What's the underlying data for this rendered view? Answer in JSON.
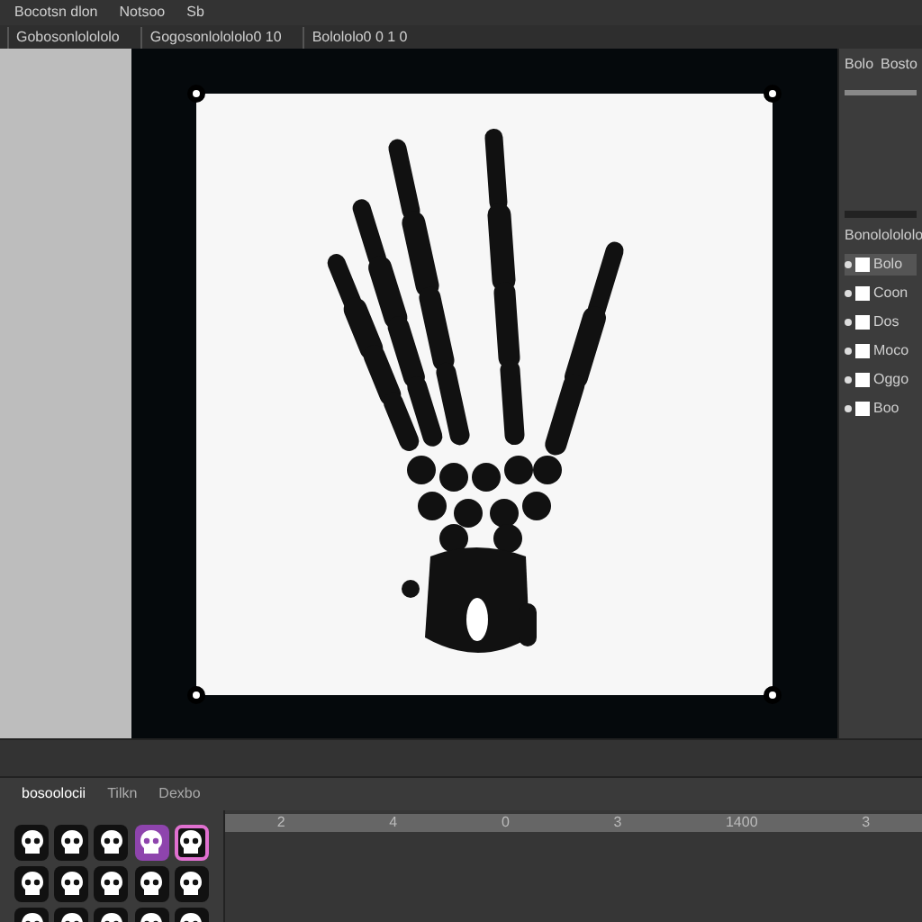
{
  "menu": [
    "Bocotsn dlon",
    "Notsoo",
    "Sb"
  ],
  "toolbar": [
    "Gobosonlolololo",
    "Gogosonlolololo0 10",
    "Bolololo0 0 1 0"
  ],
  "properties_panel": {
    "tabs": [
      "Bolo",
      "Bosto"
    ]
  },
  "layers_panel": {
    "title": "Bonololololo",
    "layers": [
      {
        "name": "Bolo",
        "selected": true
      },
      {
        "name": "Coon",
        "selected": false
      },
      {
        "name": "Dos",
        "selected": false
      },
      {
        "name": "Moco",
        "selected": false
      },
      {
        "name": "Oggo",
        "selected": false
      },
      {
        "name": "Boo",
        "selected": false
      }
    ]
  },
  "bottom_tabs": [
    {
      "label": "bosoolocii",
      "selected": true
    },
    {
      "label": "Tilkn",
      "selected": false
    },
    {
      "label": "Dexbo",
      "selected": false
    }
  ],
  "tiles": [
    {
      "selected": false,
      "color": "#111111"
    },
    {
      "selected": false,
      "color": "#111111"
    },
    {
      "selected": false,
      "color": "#111111"
    },
    {
      "selected": false,
      "color": "#8e44ad"
    },
    {
      "selected": true,
      "color": "#111111"
    },
    {
      "selected": false,
      "color": "#111111"
    },
    {
      "selected": false,
      "color": "#111111"
    },
    {
      "selected": false,
      "color": "#111111"
    },
    {
      "selected": false,
      "color": "#111111"
    },
    {
      "selected": false,
      "color": "#111111"
    },
    {
      "selected": false,
      "color": "#111111"
    },
    {
      "selected": false,
      "color": "#111111"
    },
    {
      "selected": false,
      "color": "#111111"
    },
    {
      "selected": false,
      "color": "#111111"
    },
    {
      "selected": false,
      "color": "#111111"
    }
  ],
  "timeline": {
    "ruler": [
      "2",
      "4",
      "0",
      "3",
      "1400",
      "3"
    ]
  }
}
